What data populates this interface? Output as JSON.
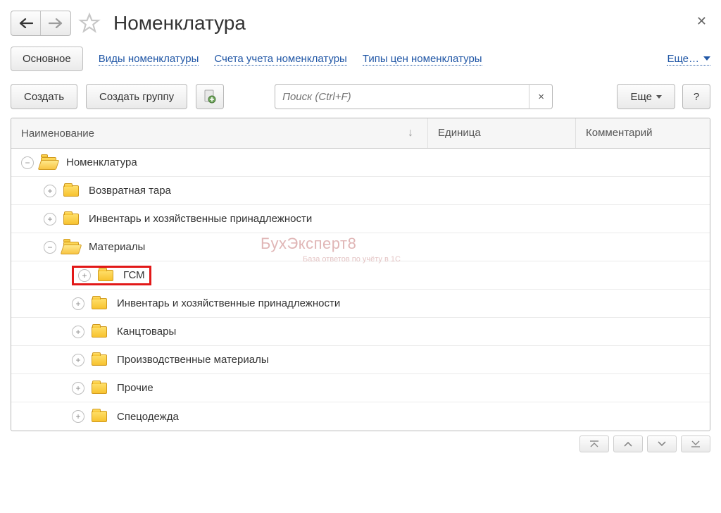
{
  "header": {
    "title": "Номенклатура"
  },
  "tabs": {
    "main": "Основное",
    "links": [
      "Виды номенклатуры",
      "Счета учета номенклатуры",
      "Типы цен номенклатуры"
    ],
    "more": "Еще…"
  },
  "toolbar": {
    "create": "Создать",
    "create_group": "Создать группу",
    "search_placeholder": "Поиск (Ctrl+F)",
    "more": "Еще",
    "help": "?"
  },
  "columns": {
    "name": "Наименование",
    "unit": "Единица",
    "comment": "Комментарий"
  },
  "tree": {
    "root": "Номенклатура",
    "items_level1": [
      "Возвратная тара",
      "Инвентарь и хозяйственные принадлежности",
      "Материалы"
    ],
    "items_level2": [
      "ГСМ",
      "Инвентарь и хозяйственные принадлежности",
      "Канцтовары",
      "Производственные материалы",
      "Прочие",
      "Спецодежда"
    ]
  },
  "watermark": {
    "title": "БухЭксперт8",
    "subtitle": "База ответов по учёту в 1С"
  }
}
